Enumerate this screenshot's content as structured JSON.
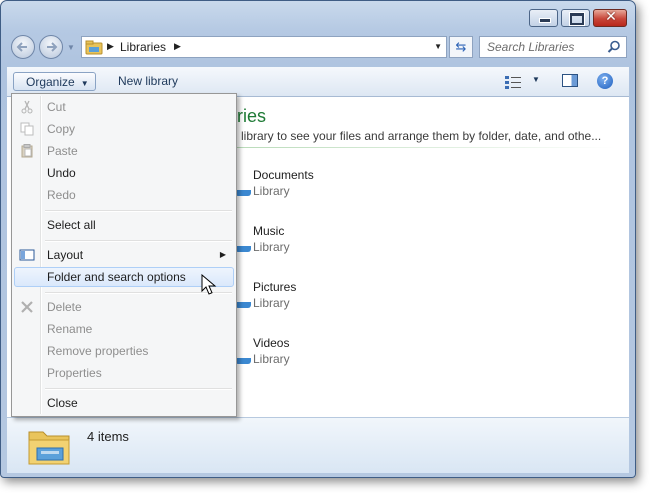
{
  "window": {
    "nav_dropdown_icon": "chevron-down-icon"
  },
  "address_bar": {
    "location": "Libraries",
    "folder_icon": "libraries-folder-icon"
  },
  "search": {
    "placeholder": "Search Libraries"
  },
  "command_bar": {
    "organize_label": "Organize",
    "new_library_label": "New library"
  },
  "libraries": {
    "title": "ries",
    "description": "library to see your files and arrange them by folder, date, and othe...",
    "items": [
      {
        "name": "Documents",
        "type": "Library"
      },
      {
        "name": "Music",
        "type": "Library"
      },
      {
        "name": "Pictures",
        "type": "Library"
      },
      {
        "name": "Videos",
        "type": "Library"
      }
    ]
  },
  "details_pane": {
    "count_text": "4 items"
  },
  "organize_menu": {
    "items": [
      {
        "label": "Cut",
        "enabled": false,
        "icon": "scissors-icon"
      },
      {
        "label": "Copy",
        "enabled": false,
        "icon": "copy-icon"
      },
      {
        "label": "Paste",
        "enabled": false,
        "icon": "paste-icon"
      },
      {
        "label": "Undo",
        "enabled": true
      },
      {
        "label": "Redo",
        "enabled": false
      },
      {
        "label": "Select all",
        "enabled": true
      },
      {
        "label": "Layout",
        "enabled": true,
        "icon": "layout-icon",
        "submenu": true
      },
      {
        "label": "Folder and search options",
        "enabled": true,
        "highlighted": true
      },
      {
        "label": "Delete",
        "enabled": false,
        "icon": "delete-x-icon"
      },
      {
        "label": "Rename",
        "enabled": false
      },
      {
        "label": "Remove properties",
        "enabled": false
      },
      {
        "label": "Properties",
        "enabled": false
      },
      {
        "label": "Close",
        "enabled": true
      }
    ]
  },
  "colors": {
    "library_title": "#1e7a35",
    "menu_highlight": "#dae8fb",
    "disabled_text": "#8e8e8e"
  }
}
